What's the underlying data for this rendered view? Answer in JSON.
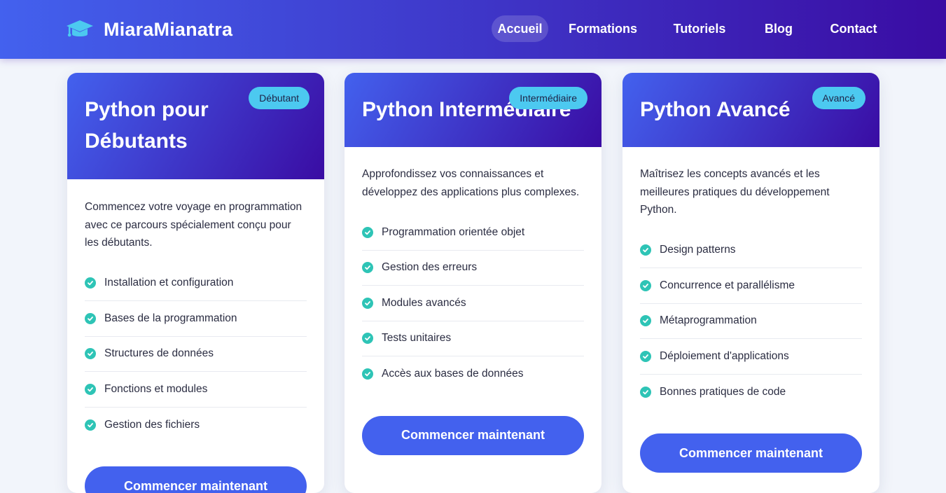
{
  "brand": {
    "name": "MiaraMianatra",
    "icon": "graduation-cap-icon"
  },
  "nav": {
    "links": [
      {
        "label": "Accueil",
        "active": true
      },
      {
        "label": "Formations",
        "active": false
      },
      {
        "label": "Tutoriels",
        "active": false
      },
      {
        "label": "Blog",
        "active": false
      },
      {
        "label": "Contact",
        "active": false
      }
    ]
  },
  "colors": {
    "primary": "#4361ee",
    "primary_dark": "#3a0ca3",
    "badge": "#4cc9f0",
    "check": "#2ec4b6",
    "text": "#2b2d42"
  },
  "courses": [
    {
      "title_line1": "Python pour",
      "title_line2": "Débutants",
      "badge": "Débutant",
      "description": "Commencez votre voyage en programmation avec ce parcours spécialement conçu pour les débutants.",
      "features": [
        "Installation et configuration",
        "Bases de la programmation",
        "Structures de données",
        "Fonctions et modules",
        "Gestion des fichiers"
      ],
      "cta": "Commencer maintenant"
    },
    {
      "title_line1": "Python Intermédiaire",
      "badge": "Intermédiaire",
      "description": "Approfondissez vos connaissances et développez des applications plus complexes.",
      "features": [
        "Programmation orientée objet",
        "Gestion des erreurs",
        "Modules avancés",
        "Tests unitaires",
        "Accès aux bases de données"
      ],
      "cta": "Commencer maintenant"
    },
    {
      "title_line1": "Python Avancé",
      "badge": "Avancé",
      "description": "Maîtrisez les concepts avancés et les meilleures pratiques du développement Python.",
      "features": [
        "Design patterns",
        "Concurrence et parallélisme",
        "Métaprogrammation",
        "Déploiement d'applications",
        "Bonnes pratiques de code"
      ],
      "cta": "Commencer maintenant"
    }
  ]
}
